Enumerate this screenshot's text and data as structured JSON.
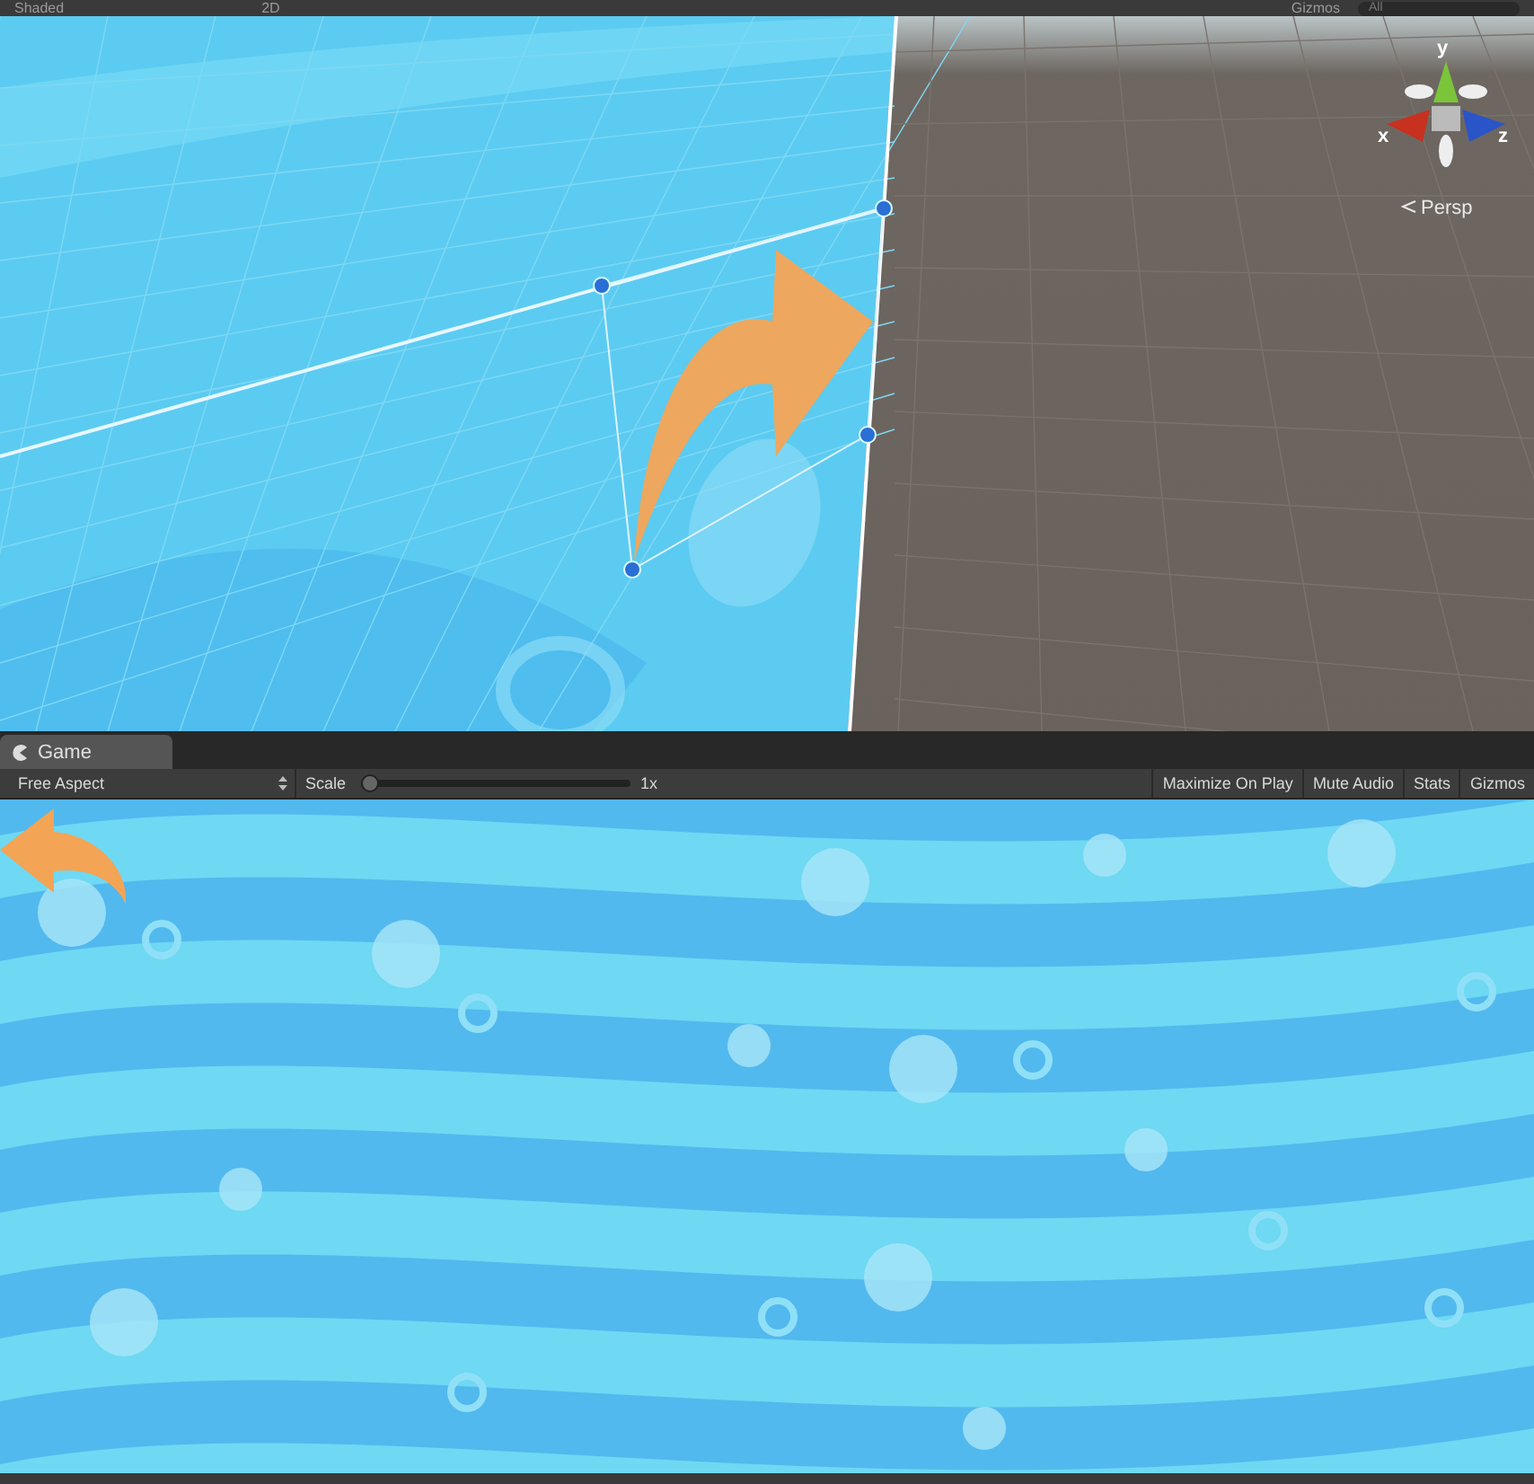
{
  "scene_toolbar": {
    "shading": "Shaded",
    "mode_2d": "2D",
    "gizmos": "Gizmos",
    "search": {
      "placeholder": "All"
    }
  },
  "scene_view": {
    "axes": [
      {
        "label": "y",
        "kind": "y"
      },
      {
        "label": "x",
        "kind": "x"
      },
      {
        "label": "z",
        "kind": "z"
      }
    ],
    "projection": "Persp"
  },
  "game_tab": {
    "label": "Game",
    "selected": true
  },
  "game_toolbar": {
    "aspect": "Free Aspect",
    "scale_label": "Scale",
    "scale": {
      "level": 0
    },
    "scale_value": "1x",
    "buttons": [
      "Maximize On Play",
      "Mute Audio",
      "Stats",
      "Gizmos"
    ]
  }
}
